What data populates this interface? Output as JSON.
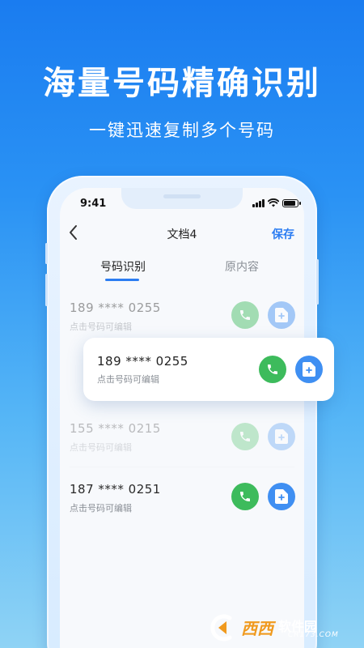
{
  "promo": {
    "headline": "海量号码精确识别",
    "subline": "一键迅速复制多个号码"
  },
  "status_bar": {
    "time": "9:41",
    "battery_level": 0.85
  },
  "nav": {
    "back_icon": "chevron-left-icon",
    "title": "文档4",
    "save_label": "保存"
  },
  "tabs": [
    {
      "label": "号码识别",
      "active": true
    },
    {
      "label": "原内容",
      "active": false
    }
  ],
  "list": [
    {
      "number": "189 **** 0255",
      "hint": "点击号码可编辑"
    },
    {
      "number": "155 **** 0215",
      "hint": "点击号码可编辑"
    },
    {
      "number": "187 **** 0251",
      "hint": "点击号码可编辑"
    }
  ],
  "highlight_card": {
    "number": "189 **** 0255",
    "hint": "点击号码可编辑"
  },
  "colors": {
    "accent": "#2c7df2",
    "call_green": "#3dbb5c",
    "add_blue": "#3f8ff2"
  },
  "icons": {
    "call": "phone-icon",
    "add": "add-document-icon"
  },
  "watermark": {
    "text": "西西",
    "brand": "软件园",
    "url": "CR173.COM"
  }
}
